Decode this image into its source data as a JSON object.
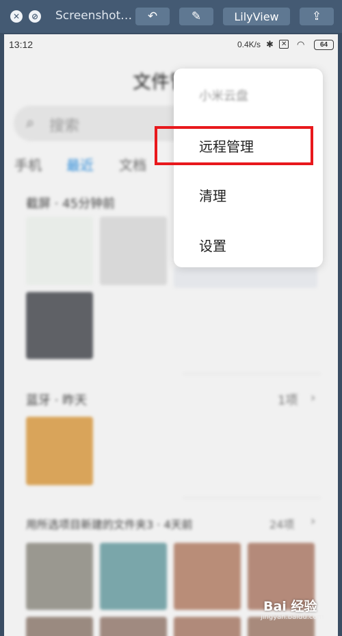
{
  "toolbar": {
    "title": "Screenshot…",
    "lilyview_label": "LilyView",
    "close_glyph": "✕",
    "cancel_glyph": "⊘",
    "rotate_glyph": "↶",
    "markup_glyph": "✎",
    "share_glyph": "⇪"
  },
  "status": {
    "time": "13:12",
    "net_speed": "0.4K/s",
    "battery": "64"
  },
  "app": {
    "title": "文件管理",
    "search_placeholder": "搜索",
    "tabs": [
      "手机",
      "最近",
      "文档"
    ],
    "sections": [
      {
        "title": "截屏 · 45分钟前"
      },
      {
        "title": "蓝牙 · 昨天",
        "count": "1项"
      },
      {
        "title": "用所选项目新建的文件夹3 · 4天前",
        "count": "24项"
      }
    ]
  },
  "menu": {
    "items": [
      "小米云盘",
      "远程管理",
      "清理",
      "设置"
    ]
  },
  "watermark": {
    "logo": "Bai 经验",
    "url": "jingyan.baidu.com"
  },
  "colors": {
    "accent_blue": "#2a8ad8",
    "highlight_red": "#e8181c",
    "toolbar_bg": "#445a73"
  }
}
